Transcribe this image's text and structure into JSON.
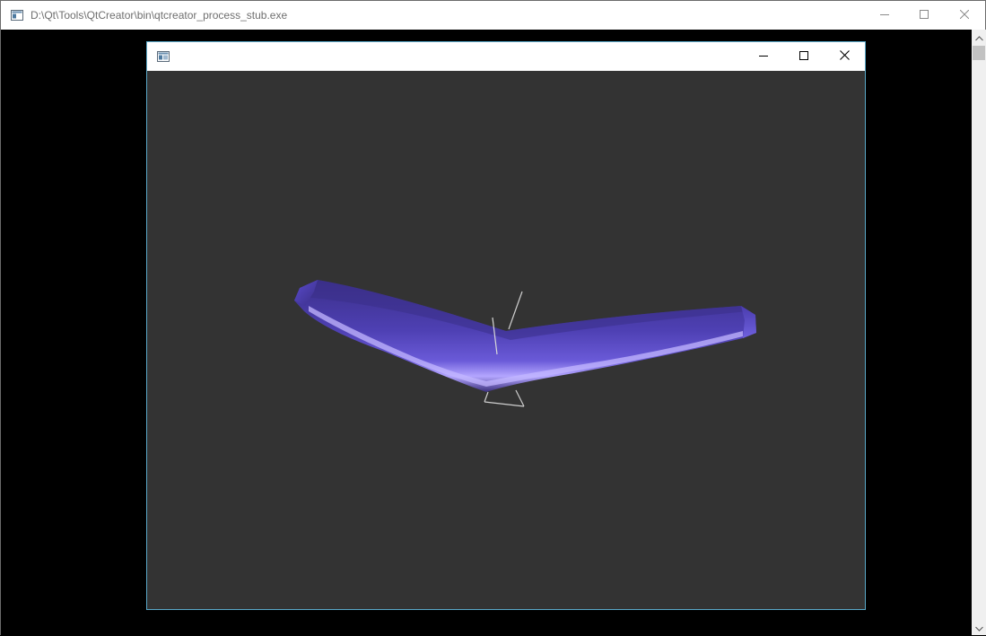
{
  "outer_window": {
    "title": "D:\\Qt\\Tools\\QtCreator\\bin\\qtcreator_process_stub.exe",
    "icon": "console-app-icon"
  },
  "inner_window": {
    "title": "",
    "icon": "qt-app-icon",
    "background_color": "#333333"
  },
  "scene": {
    "object": "flying-wing-model",
    "wing_color": "#4a3ca0",
    "highlight_color": "#b7a8ff",
    "axes_color": "#cfcfcf"
  },
  "caption_buttons": {
    "minimize": "minimize-icon",
    "maximize": "maximize-icon",
    "close": "close-icon"
  }
}
